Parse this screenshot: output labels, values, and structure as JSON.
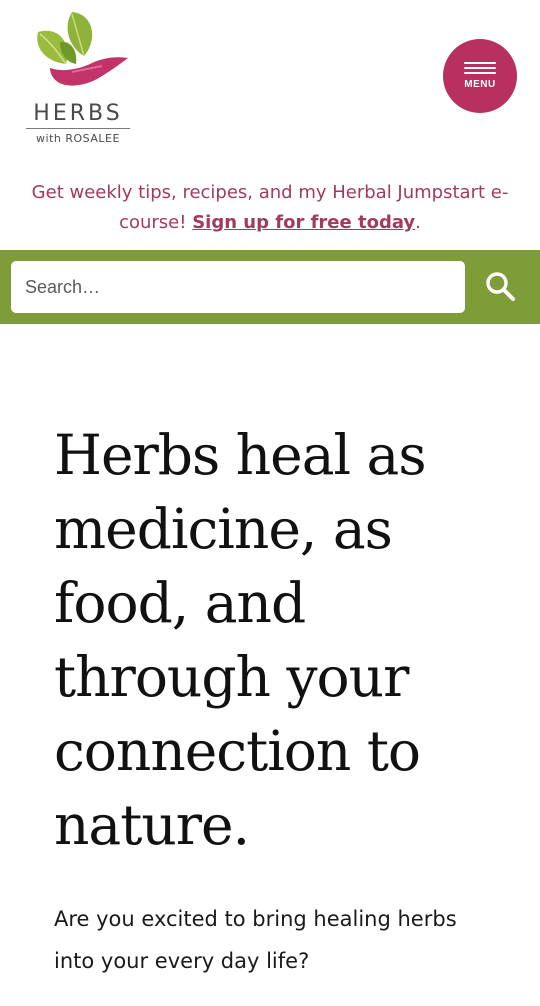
{
  "header": {
    "logo": {
      "name": "HERBS",
      "sub": "with ROSALEE"
    },
    "menu_label": "MENU"
  },
  "promo": {
    "text": "Get weekly tips, recipes, and my Herbal Jumpstart e-course! ",
    "link": "Sign up for free today",
    "tail": "."
  },
  "search": {
    "placeholder": "Search…"
  },
  "hero": {
    "title": "Herbs heal as medicine, as food, and through your connection to nature.",
    "subtitle": "Are you excited to bring healing herbs into your every day life?"
  },
  "colors": {
    "accent": "#b8305f",
    "promo_text": "#a23a5f",
    "search_bar": "#7e9c38",
    "leaf_green": "#8fb33a"
  },
  "icons": {
    "logo": "leaves-hand-icon",
    "menu": "hamburger-icon",
    "search": "search-icon"
  }
}
